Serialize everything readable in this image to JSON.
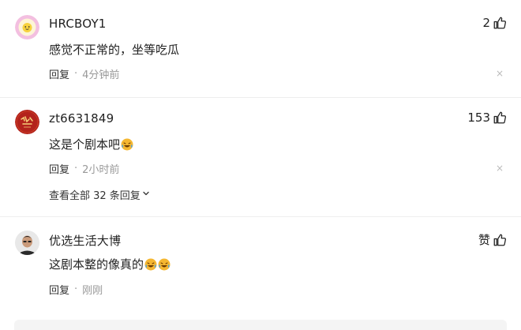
{
  "comments": [
    {
      "username": "HRCBOY1",
      "likes": "2",
      "text": "感觉不正常的，坐等吃瓜",
      "reply_label": "回复",
      "separator": "·",
      "time": "4分钟前",
      "close": "×",
      "avatar_icon": "egg-face-icon"
    },
    {
      "username": "zt6631849",
      "likes": "153",
      "text": "这是个剧本吧",
      "reply_label": "回复",
      "separator": "·",
      "time": "2小时前",
      "close": "×",
      "avatar_icon": "red-calligraphy-avatar",
      "view_all": "查看全部 32 条回复"
    },
    {
      "username": "优选生活大博",
      "likes": "赞",
      "text": "这剧本整的像真的",
      "reply_label": "回复",
      "separator": "·",
      "time": "刚刚",
      "avatar_icon": "man-photo-avatar"
    }
  ],
  "colors": {
    "text": "#222222",
    "muted": "#999999",
    "emoji": "#f5b731"
  },
  "icons": {
    "like": "thumbs-up-icon",
    "emoji": "laughing-tears-emoji",
    "chevron": "chevron-down-icon"
  }
}
